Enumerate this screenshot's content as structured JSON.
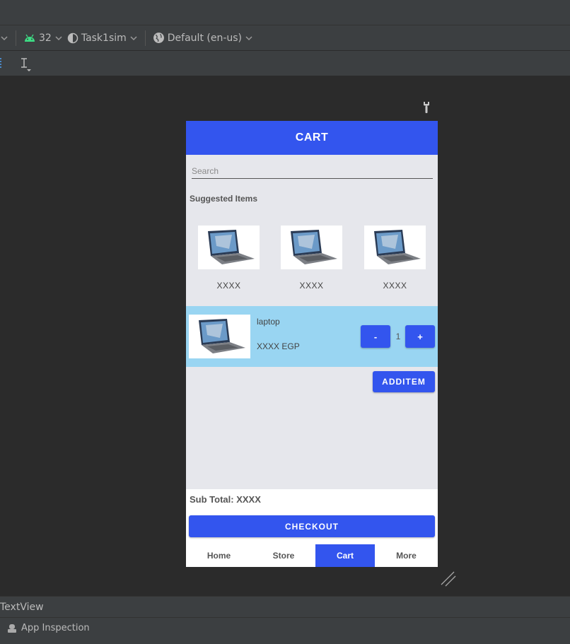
{
  "ide": {
    "toolbar": {
      "api_level": "32",
      "device": "Task1sim",
      "locale": "Default (en-us)"
    },
    "status": {
      "selected_component": "TextView",
      "app_inspection": "App Inspection"
    }
  },
  "app": {
    "title": "CART",
    "search_placeholder": "Search",
    "suggested_title": "Suggested Items",
    "suggested_items": [
      {
        "name": "XXXX"
      },
      {
        "name": "XXXX"
      },
      {
        "name": "XXXX"
      }
    ],
    "cart_item": {
      "name": "laptop",
      "price": "XXXX EGP",
      "quantity": "1",
      "minus_label": "-",
      "plus_label": "+"
    },
    "add_item_label": "ADDITEM",
    "subtotal": "Sub Total: XXXX",
    "checkout_label": "CHECKOUT",
    "nav": [
      "Home",
      "Store",
      "Cart",
      "More"
    ],
    "active_nav": "Cart",
    "colors": {
      "primary": "#3355ee",
      "cart_row": "#99d5f2",
      "background": "#e6e7ec"
    }
  }
}
